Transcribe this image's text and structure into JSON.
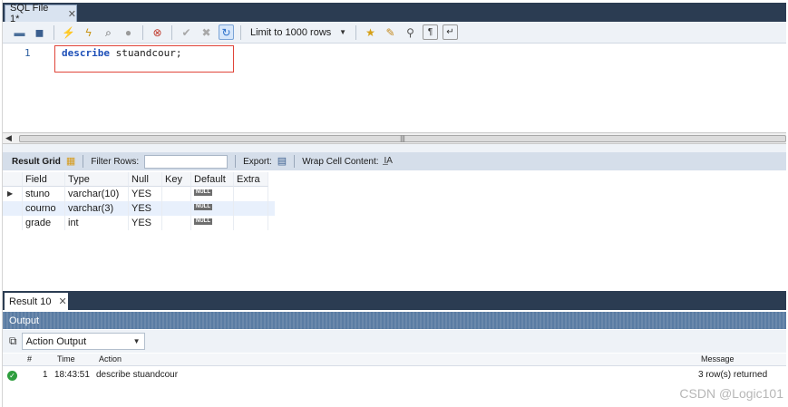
{
  "editor_tab": {
    "label": "SQL File 1*",
    "close": "✕"
  },
  "toolbar": {
    "icons": [
      "open-folder-icon",
      "save-icon",
      "execute-icon",
      "execute-current-icon",
      "explain-icon",
      "stop-icon",
      "toggle-error-icon",
      "commit-icon",
      "rollback-icon",
      "autocommit-icon",
      "beautify-icon",
      "find-icon",
      "invisible-chars-icon",
      "wrap-icon"
    ],
    "limit_label": "Limit to 1000 rows"
  },
  "editor": {
    "line_number": "1",
    "keyword": "describe",
    "rest": " stuandcour;",
    "highlight_color": "#e0453a"
  },
  "result_toolbar": {
    "result_grid": "Result Grid",
    "filter_rows": "Filter Rows:",
    "export": "Export:",
    "wrap_cell": "Wrap Cell Content:"
  },
  "grid": {
    "columns": [
      "Field",
      "Type",
      "Null",
      "Key",
      "Default",
      "Extra"
    ],
    "rows": [
      {
        "field": "stuno",
        "type": "varchar(10)",
        "null": "YES",
        "key": "",
        "default": "NULL",
        "extra": ""
      },
      {
        "field": "courno",
        "type": "varchar(3)",
        "null": "YES",
        "key": "",
        "default": "NULL",
        "extra": ""
      },
      {
        "field": "grade",
        "type": "int",
        "null": "YES",
        "key": "",
        "default": "NULL",
        "extra": ""
      }
    ]
  },
  "result_tab": {
    "label": "Result 10",
    "close": "✕"
  },
  "output": {
    "title": "Output",
    "selector": "Action Output",
    "headers": {
      "num": "#",
      "time": "Time",
      "action": "Action",
      "message": "Message"
    },
    "row": {
      "num": "1",
      "time": "18:43:51",
      "action": "describe stuandcour",
      "message": "3 row(s) returned"
    }
  },
  "watermark": "CSDN @Logic101"
}
